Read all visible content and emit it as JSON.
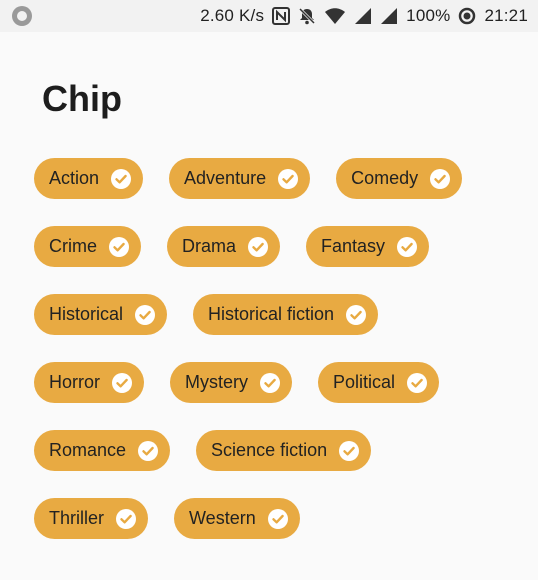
{
  "status_bar": {
    "speed": "2.60 K/s",
    "battery": "100%",
    "time": "21:21",
    "icons": [
      "circle-notification-icon",
      "nfc-icon",
      "notifications-off-icon",
      "wifi-icon",
      "signal-icon",
      "signal-icon-2",
      "battery-icon"
    ]
  },
  "page": {
    "title": "Chip"
  },
  "chips": {
    "rows": [
      [
        {
          "label": "Action"
        },
        {
          "label": "Adventure"
        },
        {
          "label": "Comedy"
        }
      ],
      [
        {
          "label": "Crime"
        },
        {
          "label": "Drama"
        },
        {
          "label": "Fantasy"
        }
      ],
      [
        {
          "label": "Historical"
        },
        {
          "label": "Historical fiction"
        }
      ],
      [
        {
          "label": "Horror"
        },
        {
          "label": "Mystery"
        },
        {
          "label": "Political"
        }
      ],
      [
        {
          "label": "Romance"
        },
        {
          "label": "Science fiction"
        }
      ],
      [
        {
          "label": "Thriller"
        },
        {
          "label": "Western"
        }
      ]
    ],
    "color": "#e8aa42",
    "selected_icon": "check-circle-icon"
  }
}
